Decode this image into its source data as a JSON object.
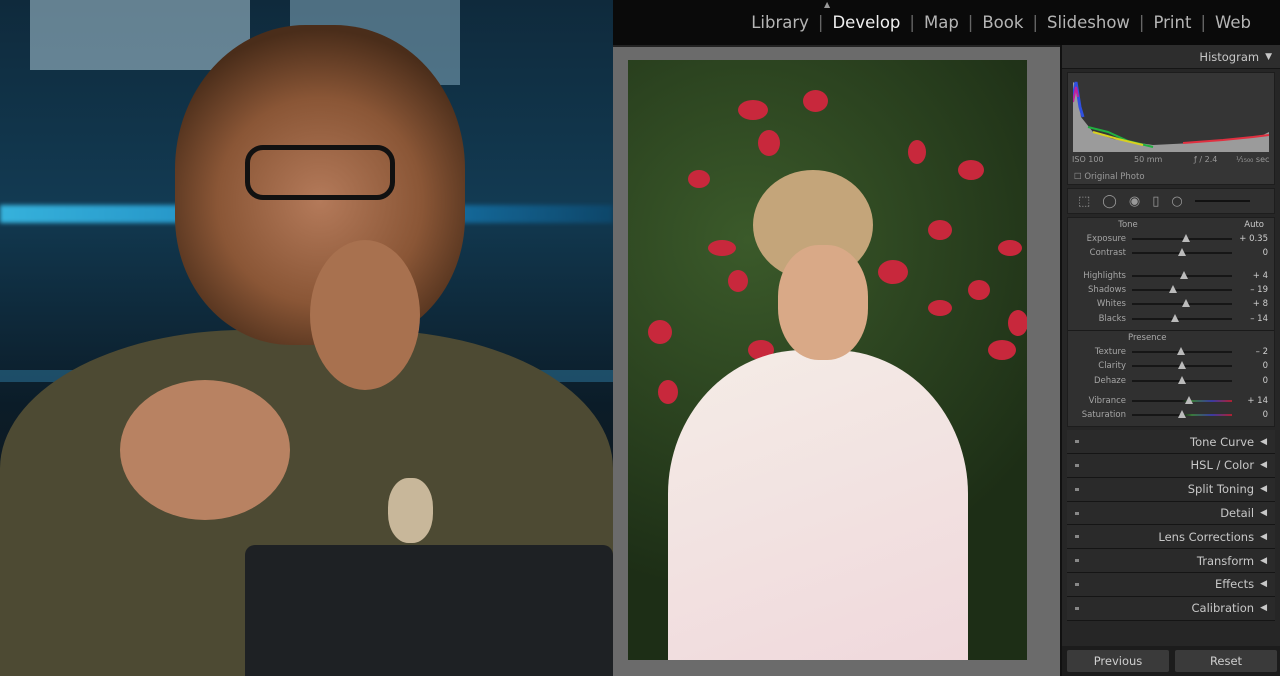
{
  "modules": [
    {
      "label": "Library",
      "active": false
    },
    {
      "label": "Develop",
      "active": true
    },
    {
      "label": "Map",
      "active": false
    },
    {
      "label": "Book",
      "active": false
    },
    {
      "label": "Slideshow",
      "active": false
    },
    {
      "label": "Print",
      "active": false
    },
    {
      "label": "Web",
      "active": false
    }
  ],
  "histogram": {
    "title": "Histogram",
    "iso": "ISO 100",
    "focal": "50 mm",
    "aperture": "ƒ / 2.4",
    "shutter": "¹⁄₁₅₀₀ sec",
    "original_photo": "Original Photo"
  },
  "basic": {
    "tone_label": "Tone",
    "auto_label": "Auto",
    "presence_label": "Presence",
    "tone": [
      {
        "label": "Exposure",
        "value": "+ 0.35",
        "num": 0.35,
        "min": -5,
        "max": 5
      },
      {
        "label": "Contrast",
        "value": "0",
        "num": 0,
        "min": -100,
        "max": 100
      }
    ],
    "tone2": [
      {
        "label": "Highlights",
        "value": "+ 4",
        "num": 4,
        "min": -100,
        "max": 100
      },
      {
        "label": "Shadows",
        "value": "– 19",
        "num": -19,
        "min": -100,
        "max": 100
      },
      {
        "label": "Whites",
        "value": "+ 8",
        "num": 8,
        "min": -100,
        "max": 100
      },
      {
        "label": "Blacks",
        "value": "– 14",
        "num": -14,
        "min": -100,
        "max": 100
      }
    ],
    "presence": [
      {
        "label": "Texture",
        "value": "– 2",
        "num": -2,
        "min": -100,
        "max": 100
      },
      {
        "label": "Clarity",
        "value": "0",
        "num": 0,
        "min": -100,
        "max": 100
      },
      {
        "label": "Dehaze",
        "value": "0",
        "num": 0,
        "min": -100,
        "max": 100
      }
    ],
    "presence2": [
      {
        "label": "Vibrance",
        "value": "+ 14",
        "num": 14,
        "min": -100,
        "max": 100
      },
      {
        "label": "Saturation",
        "value": "0",
        "num": 0,
        "min": -100,
        "max": 100
      }
    ]
  },
  "panels": [
    "Tone Curve",
    "HSL / Color",
    "Split Toning",
    "Detail",
    "Lens Corrections",
    "Transform",
    "Effects",
    "Calibration"
  ],
  "buttons": {
    "previous": "Previous",
    "reset": "Reset"
  }
}
